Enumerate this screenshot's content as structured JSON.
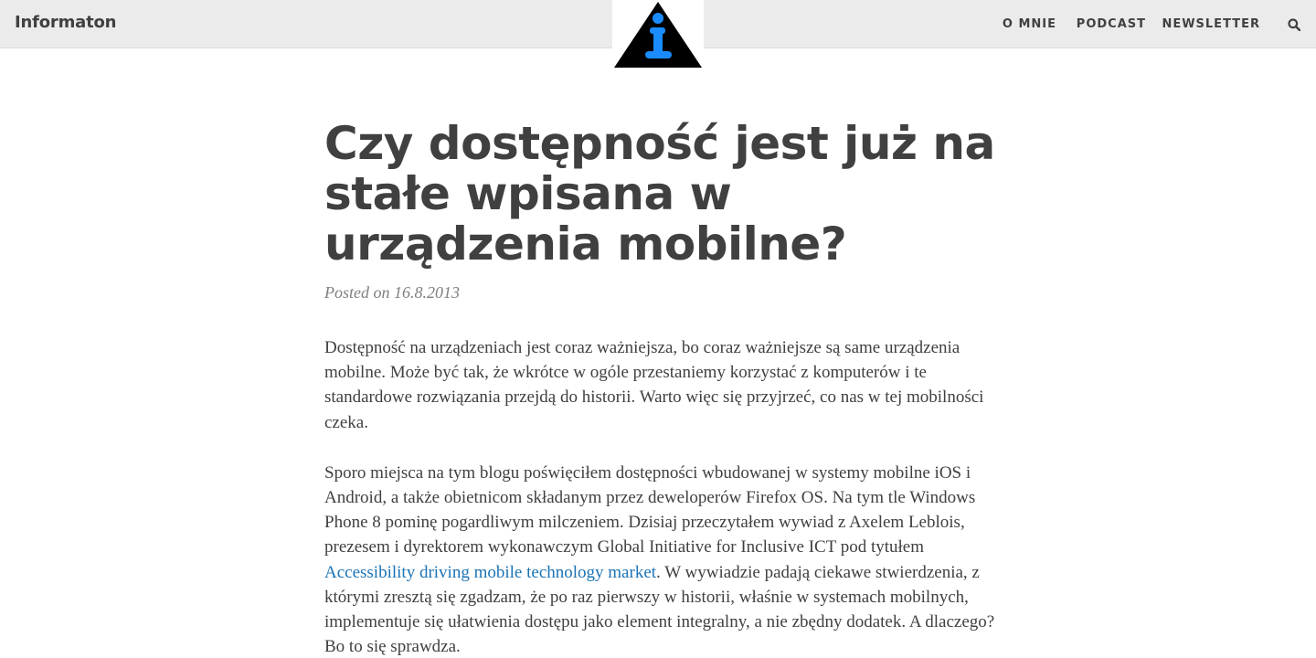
{
  "header": {
    "brand": "Informaton",
    "logo": {
      "icon": "info-triangle-logo",
      "letter": "i",
      "accent": "#1a8cff",
      "dark": "#000000"
    },
    "nav": [
      {
        "label": "O MNIE"
      },
      {
        "label": "PODCAST"
      },
      {
        "label": "NEWSLETTER"
      }
    ],
    "search_icon": "search-icon"
  },
  "post": {
    "title": "Czy dostępność jest już na stałe wpisana w urządzenia mobilne?",
    "meta": "Posted on 16.8.2013",
    "paragraph1": "Dostępność na urządzeniach jest coraz ważniejsza, bo coraz ważniejsze są same urządzenia mobilne. Może być tak, że wkrótce w ogóle przestaniemy korzystać z komputerów i te standardowe rozwiązania przejdą do historii. Warto więc się przyjrzeć, co nas w tej mobilności czeka.",
    "paragraph2_before_link": "Sporo miejsca na tym blogu poświęciłem dostępności wbudowanej w systemy mobilne iOS i Android, a także obietnicom składanym przez deweloperów Firefox OS. Na tym tle Windows Phone 8 pominę pogardliwym milczeniem. Dzisiaj przeczytałem wywiad z Axelem Leblois, prezesem i dyrektorem wykonawczym Global Initiative for Inclusive ICT pod tytułem ",
    "paragraph2_link": "Accessibility driving mobile technology market",
    "paragraph2_after_link": ". W wywiadzie padają ciekawe stwierdzenia, z którymi zresztą się zgadzam, że po raz pierwszy w historii, właśnie w systemach mobilnych, implementuje się ułatwienia dostępu jako element integralny, a nie zbędny dodatek. A dlaczego? Bo to się sprawdza."
  },
  "colors": {
    "topbar_bg": "#ebebeb",
    "text": "#404040",
    "meta": "#808080",
    "link": "#1a73b5"
  }
}
